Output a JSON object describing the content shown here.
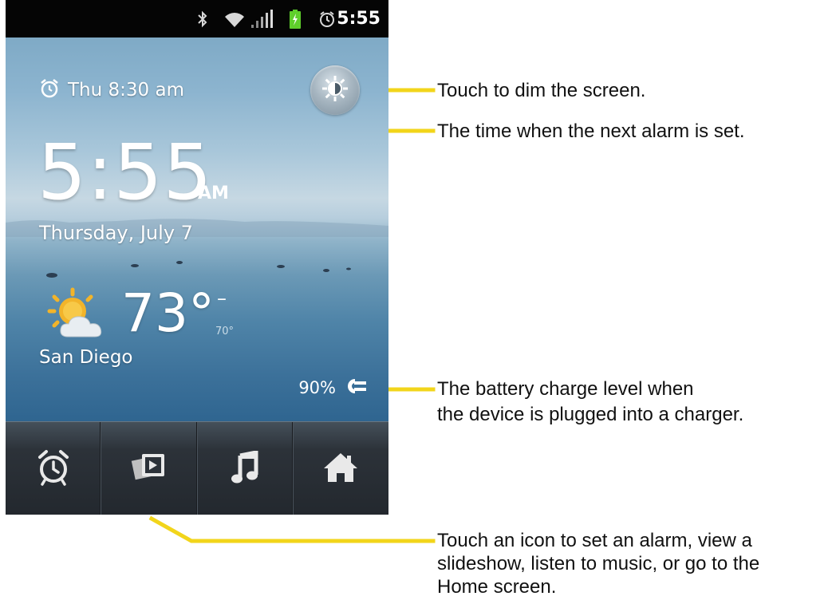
{
  "status_bar": {
    "time": "5:55",
    "icons": [
      "bluetooth-icon",
      "wifi-icon",
      "signal-icon",
      "battery-charging-icon",
      "alarm-icon"
    ]
  },
  "dock": {
    "next_alarm": "Thu 8:30 am",
    "time": "5:55",
    "ampm": "AM",
    "date": "Thursday, July 7",
    "weather": {
      "temp": "73°",
      "high": "–",
      "low": "70°",
      "city": "San Diego",
      "condition_icon": "partly-cloudy-icon"
    },
    "battery": "90%",
    "bottom_buttons": [
      {
        "name": "alarm-button",
        "icon": "alarm-clock-icon"
      },
      {
        "name": "slideshow-button",
        "icon": "slideshow-icon"
      },
      {
        "name": "music-button",
        "icon": "music-note-icon"
      },
      {
        "name": "home-button",
        "icon": "home-icon"
      }
    ]
  },
  "callouts": {
    "dim": "Touch to dim the screen.",
    "alarm": "The time when the next alarm is set.",
    "battery_line1": "The battery charge level when",
    "battery_line2": "the device is plugged into a charger.",
    "icons_line1": "Touch an icon to set an alarm, view a",
    "icons_line2": "slideshow, listen to music, or go to the",
    "icons_line3": "Home screen."
  },
  "colors": {
    "callout_line": "#f2d51b",
    "wallpaper_top": "#7faac6",
    "wallpaper_bottom": "#2f6590",
    "bottom_bar": "#2c3239",
    "status_bar": "#050505"
  }
}
